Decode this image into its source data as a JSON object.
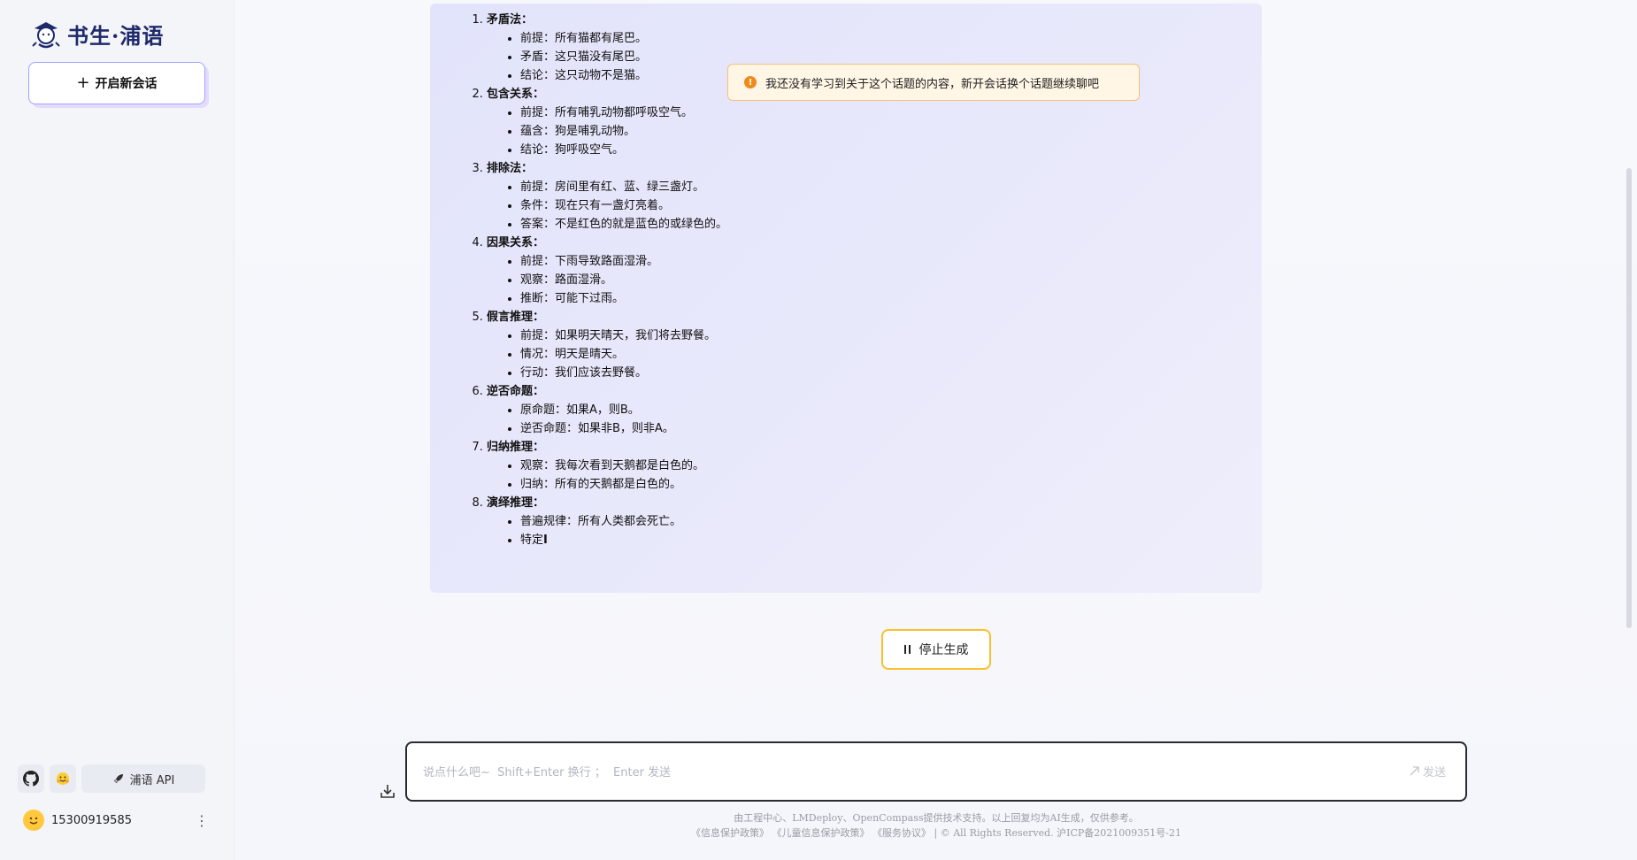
{
  "app": {
    "logo_text": "书生·浦语",
    "new_chat_label": "开启新会话"
  },
  "sidebar_bottom": {
    "api_label": "浦语 API",
    "user_phone": "15300919585"
  },
  "answer": {
    "sections": [
      {
        "num": "1.",
        "title": "矛盾法：",
        "items": [
          "前提：所有猫都有尾巴。",
          "矛盾：这只猫没有尾巴。",
          "结论：这只动物不是猫。"
        ]
      },
      {
        "num": "2.",
        "title": "包含关系：",
        "items": [
          "前提：所有哺乳动物都呼吸空气。",
          "蕴含：狗是哺乳动物。",
          "结论：狗呼吸空气。"
        ]
      },
      {
        "num": "3.",
        "title": "排除法：",
        "items": [
          "前提：房间里有红、蓝、绿三盏灯。",
          "条件：现在只有一盏灯亮着。",
          "答案：不是红色的就是蓝色的或绿色的。"
        ]
      },
      {
        "num": "4.",
        "title": "因果关系：",
        "items": [
          "前提：下雨导致路面湿滑。",
          "观察：路面湿滑。",
          "推断：可能下过雨。"
        ]
      },
      {
        "num": "5.",
        "title": "假言推理：",
        "items": [
          "前提：如果明天晴天，我们将去野餐。",
          "情况：明天是晴天。",
          "行动：我们应该去野餐。"
        ]
      },
      {
        "num": "6.",
        "title": "逆否命题：",
        "items": [
          "原命题：如果A，则B。",
          "逆否命题：如果非B，则非A。"
        ]
      },
      {
        "num": "7.",
        "title": "归纳推理：",
        "items": [
          "观察：我每次看到天鹅都是白色的。",
          "归纳：所有的天鹅都是白色的。"
        ]
      },
      {
        "num": "8.",
        "title": "演绎推理：",
        "items": [
          "普遍规律：所有人类都会死亡。",
          "特定"
        ]
      }
    ],
    "streaming_cursor": "I"
  },
  "toast": {
    "icon_glyph": "!",
    "message": "我还没有学习到关于这个话题的内容，新开会话换个话题继续聊吧"
  },
  "stop_button": {
    "label": "停止生成"
  },
  "input": {
    "placeholder": "说点什么吧~  Shift+Enter 换行 ；  Enter 发送",
    "value": "",
    "send_label": "发送"
  },
  "footer": {
    "line1": "由工程中心、LMDeploy、OpenCompass提供技术支持。以上回复均为AI生成，仅供参考。",
    "privacy": "《信息保护政策》",
    "child_privacy": "《儿童信息保护政策》",
    "service": "《服务协议》",
    "copyright": "| © All Rights Reserved. 沪ICP备2021009351号-21"
  },
  "colors": {
    "accent": "#9aa6ff",
    "warning": "#f08a1c",
    "stop_border": "#f7c02c"
  }
}
